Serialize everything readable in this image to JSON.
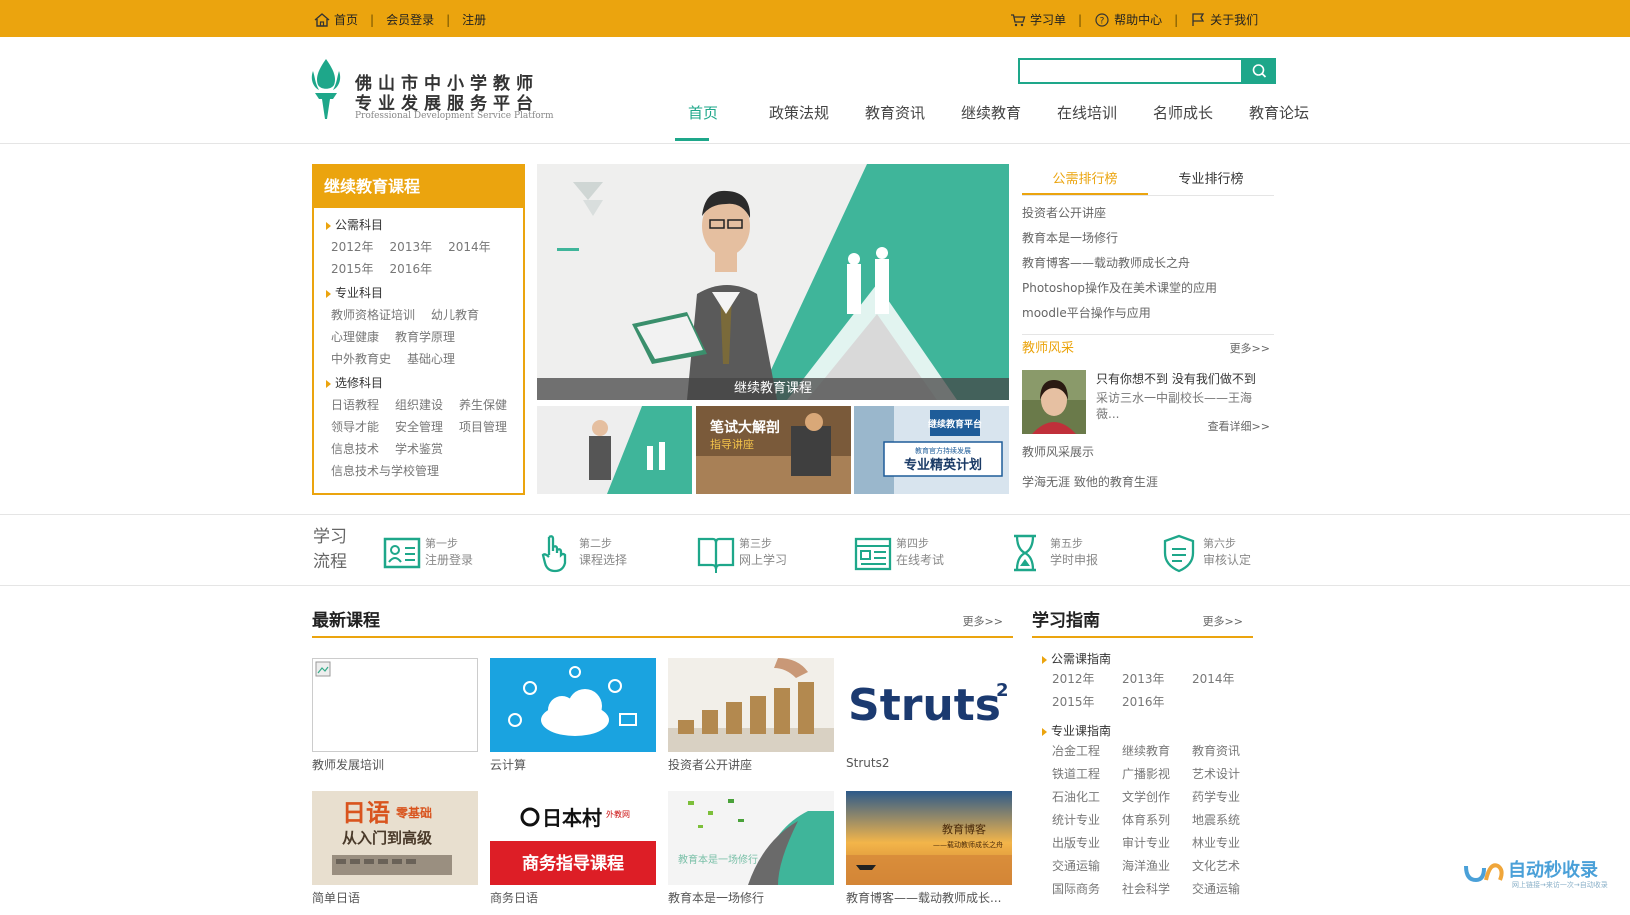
{
  "topbar": {
    "home": "首页",
    "login": "会员登录",
    "register": "注册",
    "cart": "学习单",
    "help": "帮助中心",
    "about": "关于我们",
    "sep": "|"
  },
  "logo": {
    "line1": "佛山市中小学教师",
    "line2": "专业发展服务平台",
    "english": "Professional Development Service Platform"
  },
  "search": {
    "value": "",
    "placeholder": ""
  },
  "nav": [
    "首页",
    "政策法规",
    "教育资讯",
    "继续教育",
    "在线培训",
    "名师成长",
    "教育论坛"
  ],
  "continuing": {
    "title": "继续教育课程",
    "public_label": "公需科目",
    "public_years": [
      "2012年",
      "2013年",
      "2014年",
      "2015年",
      "2016年"
    ],
    "pro_label": "专业科目",
    "pro_items": [
      "教师资格证培训",
      "幼儿教育",
      "心理健康",
      "教育学原理",
      "中外教育史",
      "基础心理"
    ],
    "elective_label": "选修科目",
    "elective_items": [
      "日语教程",
      "组织建设",
      "养生保健",
      "领导才能",
      "安全管理",
      "项目管理",
      "信息技术",
      "学术鉴赏",
      "信息技术与学校管理"
    ]
  },
  "banner": {
    "caption": "继续教育课程",
    "thumb2_title": "笔试大解剖",
    "thumb2_sub": "指导讲座",
    "thumb3_badge": "继续教育平台",
    "thumb3_small": "教育官方持续发展",
    "thumb3_title": "专业精英计划"
  },
  "rank": {
    "tab_public": "公需排行榜",
    "tab_pro": "专业排行榜",
    "items": [
      "投资者公开讲座",
      "教育本是一场修行",
      "教育博客——载动教师成长之舟",
      "Photoshop操作及在美术课堂的应用",
      "moodle平台操作与应用"
    ]
  },
  "teacher": {
    "title": "教师风采",
    "more": "更多>>",
    "headline": "只有你想不到 没有我们做不到",
    "desc": "采访三水一中副校长——王海薇...",
    "detail": "查看详细>>",
    "links": [
      "教师风采展示",
      "学海无涯 致他的教育生涯"
    ]
  },
  "process": {
    "title": "学习流程",
    "steps": [
      {
        "step": "第一步",
        "label": "注册登录",
        "icon": "id-card-icon"
      },
      {
        "step": "第二步",
        "label": "课程选择",
        "icon": "pointer-hand-icon"
      },
      {
        "step": "第三步",
        "label": "网上学习",
        "icon": "open-book-icon"
      },
      {
        "step": "第四步",
        "label": "在线考试",
        "icon": "exam-paper-icon"
      },
      {
        "step": "第五步",
        "label": "学时申报",
        "icon": "hourglass-icon"
      },
      {
        "step": "第六步",
        "label": "审核认定",
        "icon": "shield-icon"
      }
    ]
  },
  "newest": {
    "title": "最新课程",
    "more": "更多>>",
    "courses": [
      "教师发展培训",
      "云计算",
      "投资者公开讲座",
      "Struts2",
      "简单日语",
      "商务日语",
      "教育本是一场修行",
      "教育博客——载动教师成长..."
    ],
    "struts_logo": "Struts",
    "struts_sup": "2",
    "jp_title": "日语",
    "jp_tag": "零基础",
    "jp_sub": "从入门到高级",
    "biz_brand": "日本村",
    "biz_tag": "外教网",
    "biz_title": "商务指导课程",
    "blog_title": "教育博客",
    "blog_sub": "——载动教师成长之舟",
    "practice_text": "教育本是一场修行"
  },
  "guide": {
    "title": "学习指南",
    "more": "更多>>",
    "public_label": "公需课指南",
    "public_years": [
      "2012年",
      "2013年",
      "2014年",
      "2015年",
      "2016年"
    ],
    "pro_label": "专业课指南",
    "pro_items": [
      "冶金工程",
      "继续教育",
      "教育资讯",
      "铁道工程",
      "广播影视",
      "艺术设计",
      "石油化工",
      "文学创作",
      "药学专业",
      "统计专业",
      "体育系列",
      "地震系统",
      "出版专业",
      "审计专业",
      "林业专业",
      "交通运输",
      "海洋渔业",
      "文化艺术",
      "国际商务",
      "社会科学",
      "交通运输"
    ]
  },
  "watermark": {
    "text": "自动秒收录",
    "sub": "网上链接→来访一次→自动收录"
  },
  "colors": {
    "accent": "#eba40e",
    "brand": "#1ea78a"
  }
}
